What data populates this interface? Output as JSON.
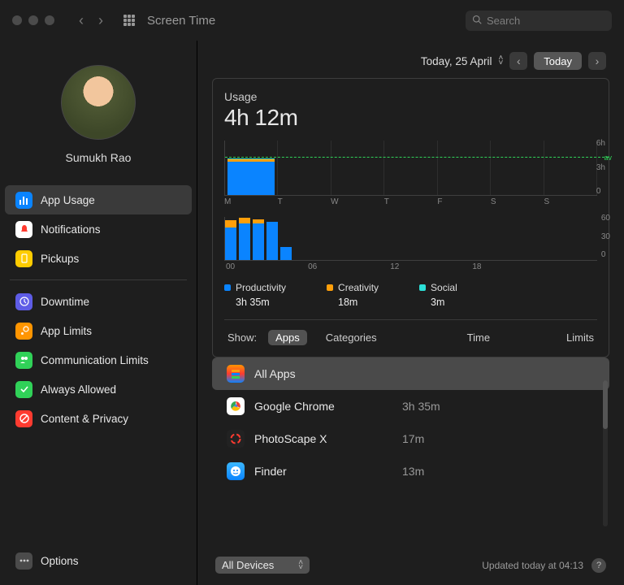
{
  "window": {
    "title": "Screen Time",
    "search_placeholder": "Search"
  },
  "profile": {
    "name": "Sumukh Rao"
  },
  "sidebar": {
    "sections": [
      [
        {
          "label": "App Usage",
          "icon": "app-usage-icon",
          "color": "#0a84ff"
        },
        {
          "label": "Notifications",
          "icon": "notifications-icon",
          "color": "#ff3b30"
        },
        {
          "label": "Pickups",
          "icon": "pickups-icon",
          "color": "#ffcc00"
        }
      ],
      [
        {
          "label": "Downtime",
          "icon": "downtime-icon",
          "color": "#5e5ce6"
        },
        {
          "label": "App Limits",
          "icon": "app-limits-icon",
          "color": "#ff9500"
        },
        {
          "label": "Communication Limits",
          "icon": "communication-limits-icon",
          "color": "#30d158"
        },
        {
          "label": "Always Allowed",
          "icon": "always-allowed-icon",
          "color": "#30d158"
        },
        {
          "label": "Content & Privacy",
          "icon": "content-privacy-icon",
          "color": "#ff3b30"
        }
      ]
    ],
    "options_label": "Options"
  },
  "header": {
    "date": "Today, 25 April",
    "today_button": "Today"
  },
  "usage": {
    "label": "Usage",
    "total": "4h 12m"
  },
  "legend": [
    {
      "name": "Productivity",
      "color": "#0a84ff",
      "time": "3h 35m"
    },
    {
      "name": "Creativity",
      "color": "#ff9f0a",
      "time": "18m"
    },
    {
      "name": "Social",
      "color": "#2ce0d8",
      "time": "3m"
    }
  ],
  "show_tabs": {
    "label": "Show:",
    "apps": "Apps",
    "categories": "Categories",
    "time": "Time",
    "limits": "Limits"
  },
  "apps": [
    {
      "name": "All Apps",
      "time": ""
    },
    {
      "name": "Google Chrome",
      "time": "3h 35m"
    },
    {
      "name": "PhotoScape X",
      "time": "17m"
    },
    {
      "name": "Finder",
      "time": "13m"
    }
  ],
  "footer": {
    "devices": "All Devices",
    "updated": "Updated today at 04:13"
  },
  "chart_data": {
    "week_chart": {
      "type": "bar",
      "ylabel": "hours",
      "ylim": [
        0,
        6
      ],
      "yticks": [
        6,
        3,
        0
      ],
      "avg_label": "av",
      "average_hours": 4.2,
      "categories": [
        "M",
        "T",
        "W",
        "T",
        "F",
        "S",
        "S"
      ],
      "series": [
        {
          "name": "Productivity",
          "color": "#0a84ff",
          "values": [
            3.6,
            0,
            0,
            0,
            0,
            0,
            0
          ]
        },
        {
          "name": "Creativity",
          "color": "#ff9f0a",
          "values": [
            0.3,
            0,
            0,
            0,
            0,
            0,
            0
          ]
        },
        {
          "name": "Social",
          "color": "#2ce0d8",
          "values": [
            0.05,
            0,
            0,
            0,
            0,
            0,
            0
          ]
        }
      ]
    },
    "hour_chart": {
      "type": "bar",
      "ylabel": "minutes",
      "ylim": [
        0,
        60
      ],
      "yticks": [
        60,
        30,
        0
      ],
      "x": [
        0,
        1,
        2,
        3,
        4
      ],
      "xticks": [
        "00",
        "06",
        "12",
        "18"
      ],
      "series": [
        {
          "name": "Productivity",
          "color": "#0a84ff",
          "values": [
            44,
            50,
            50,
            52,
            18
          ]
        },
        {
          "name": "Creativity",
          "color": "#ff9f0a",
          "values": [
            10,
            8,
            6,
            0,
            0
          ]
        },
        {
          "name": "Social",
          "color": "#2ce0d8",
          "values": [
            0,
            0,
            0,
            0,
            0
          ]
        }
      ]
    }
  }
}
